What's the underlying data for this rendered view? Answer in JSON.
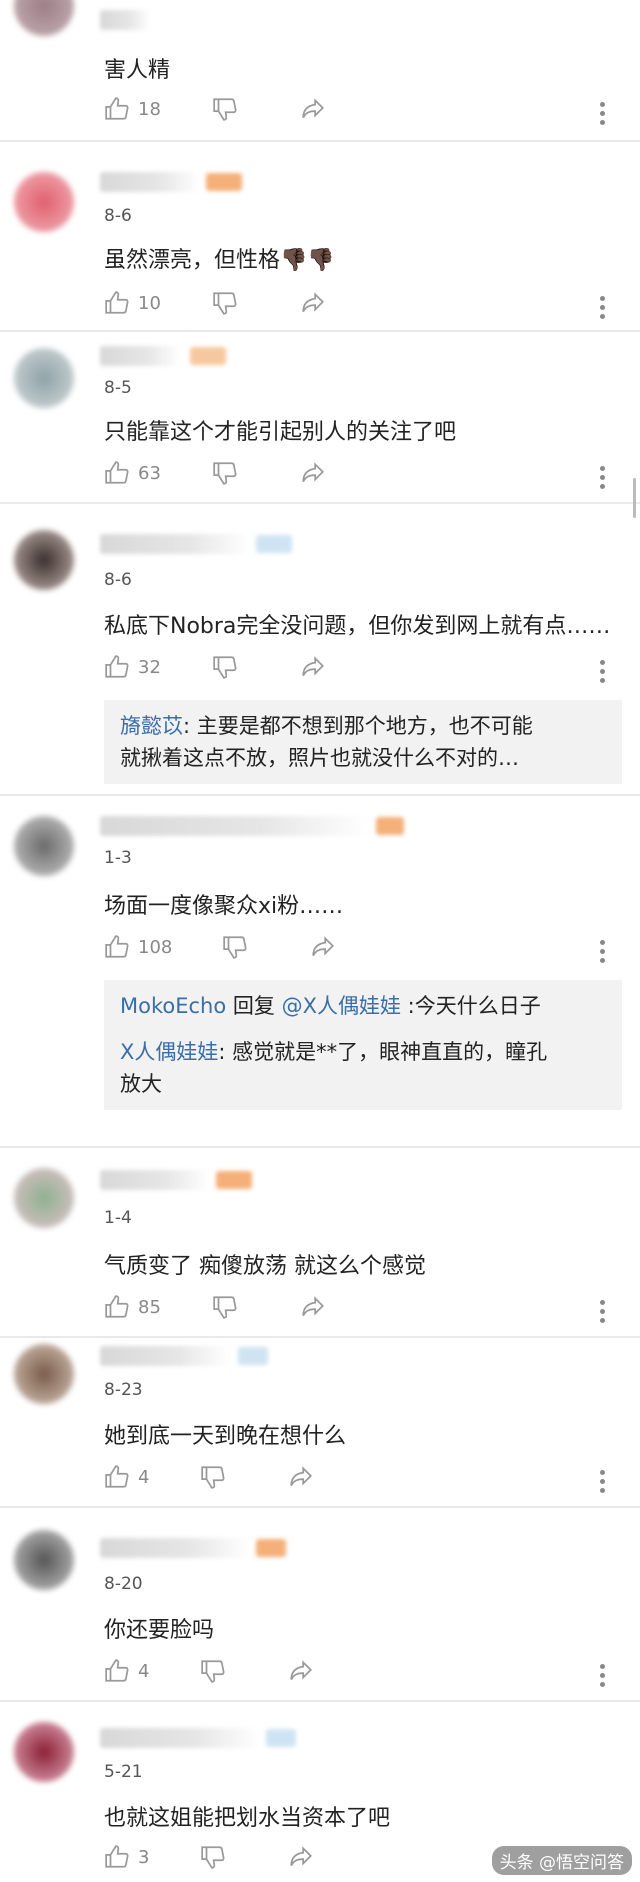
{
  "comments": [
    {
      "date": "",
      "text": "害人精",
      "likes": "18"
    },
    {
      "date": "8-6",
      "text": "虽然漂亮，但性格",
      "emoji": "👎🏿👎🏿",
      "likes": "10"
    },
    {
      "date": "8-5",
      "text": "只能靠这个才能引起别人的关注了吧",
      "likes": "63"
    },
    {
      "date": "8-6",
      "text": "私底下Nobra完全没问题，但你发到网上就有点……",
      "likes": "32",
      "replies": [
        {
          "name": "旖懿苡",
          "text": ": 主要是都不想到那个地方，也不可能",
          "text2": "就揪着这点不放，照片也就没什么不对的…"
        }
      ]
    },
    {
      "date": "1-3",
      "text": "场面一度像聚众xi粉……",
      "likes": "108",
      "replies": [
        {
          "name": "MokoEcho",
          "mid": " 回复 ",
          "target": "@X人偶娃娃",
          "text": " :今天什么日子"
        },
        {
          "name": "X人偶娃娃",
          "text": ": 感觉就是**了，眼神直直的，瞳孔",
          "text2": "放大"
        }
      ]
    },
    {
      "date": "1-4",
      "text": "气质变了  痴傻放荡   就这么个感觉",
      "likes": "85"
    },
    {
      "date": "8-23",
      "text": "她到底一天到晚在想什么",
      "likes": "4"
    },
    {
      "date": "8-20",
      "text": "你还要脸吗",
      "likes": "4"
    },
    {
      "date": "5-21",
      "text": "也就这姐能把划水当资本了吧",
      "likes": "3"
    }
  ],
  "watermark": "头条 @悟空问答",
  "colors": {
    "reply_name": "#3a6ea8",
    "reply_bg": "#f2f2f2",
    "divider": "#e9e9e9"
  },
  "icons": {
    "like": "thumbs-up-icon",
    "dislike": "thumbs-down-icon",
    "share": "share-icon",
    "more": "more-dots-icon"
  }
}
